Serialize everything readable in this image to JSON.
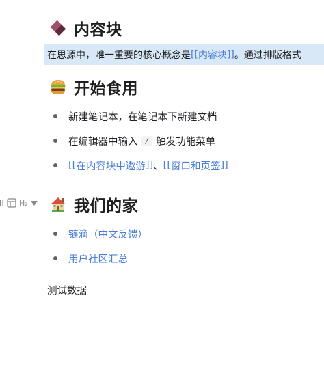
{
  "block1": {
    "title": "内容块",
    "emoji_icon": "rectangle-block-icon",
    "line_prefix": "在思源中，唯一重要的核心概念是",
    "open_bracket": "[[",
    "link_text": "内容块",
    "close_bracket": "]]",
    "line_suffix": "。通过排版格式"
  },
  "block2": {
    "title": "开始食用",
    "emoji_icon": "hamburger-icon",
    "items": [
      {
        "text": "新建笔记本，在笔记本下新建文档"
      },
      {
        "pre": "在编辑器中输入",
        "code": "/",
        "post": "触发功能菜单"
      },
      {
        "open1": "[[",
        "link1": "在内容块中遨游",
        "close1": "]]",
        "sep": "、",
        "open2": "[[",
        "link2": "窗口和页签",
        "close2": "]]"
      }
    ]
  },
  "gutter": {
    "heading_level": "H₂"
  },
  "block3": {
    "title": "我们的家",
    "emoji_icon": "house-icon",
    "items": [
      {
        "link": "链滴（中文反馈）"
      },
      {
        "link": "用户社区汇总"
      }
    ]
  },
  "paragraph": {
    "text": "测试数据"
  },
  "colors": {
    "link": "#4a7fd6",
    "highlight": "#d9e8f7"
  }
}
